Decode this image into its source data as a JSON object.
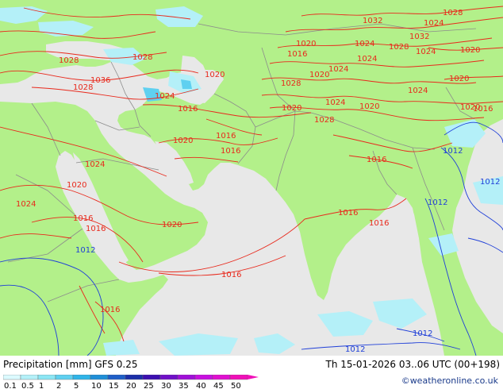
{
  "map": {
    "colors": {
      "land": "#b3f08a",
      "sea": "#e8e8e8",
      "isobar": "#e8291c",
      "isobar_low": "#1f3fd8",
      "border": "#8c8c8c",
      "precip_light": "#b4f0f8",
      "precip_mid": "#5fd0f0"
    },
    "isobar_labels_red": [
      {
        "text": "1028"
      },
      {
        "text": "1032"
      },
      {
        "text": "1024"
      },
      {
        "text": "1028"
      },
      {
        "text": "1032"
      },
      {
        "text": "1028"
      },
      {
        "text": "1024"
      },
      {
        "text": "1020"
      },
      {
        "text": "1020"
      },
      {
        "text": "1016"
      },
      {
        "text": "1024"
      },
      {
        "text": "1024"
      },
      {
        "text": "1028"
      },
      {
        "text": "1028"
      },
      {
        "text": "1020"
      },
      {
        "text": "1036"
      },
      {
        "text": "1028"
      },
      {
        "text": "1024"
      },
      {
        "text": "1016"
      },
      {
        "text": "1020"
      },
      {
        "text": "1024"
      },
      {
        "text": "1020"
      },
      {
        "text": "1020"
      },
      {
        "text": "1016"
      },
      {
        "text": "1020"
      },
      {
        "text": "1016"
      },
      {
        "text": "1016"
      },
      {
        "text": "1024"
      },
      {
        "text": "1020"
      },
      {
        "text": "1024"
      },
      {
        "text": "1016"
      },
      {
        "text": "1016"
      },
      {
        "text": "1020"
      },
      {
        "text": "1016"
      },
      {
        "text": "1016"
      },
      {
        "text": "1016"
      },
      {
        "text": "1016"
      },
      {
        "text": "1028"
      },
      {
        "text": "1020"
      },
      {
        "text": "1024"
      },
      {
        "text": "1020"
      },
      {
        "text": "1024"
      },
      {
        "text": "1016"
      }
    ],
    "isobar_labels_blue": [
      {
        "text": "1012"
      },
      {
        "text": "1012"
      },
      {
        "text": "1012"
      },
      {
        "text": "1012"
      },
      {
        "text": "1012"
      },
      {
        "text": "1012"
      }
    ]
  },
  "footer": {
    "title_left": "Precipitation [mm]  GFS 0.25",
    "title_right": "Th 15-01-2026 03..06 UTC (00+198)",
    "credit": "©weatheronline.co.uk",
    "scale": {
      "ticks": [
        "0.1",
        "0.5",
        "1",
        "2",
        "5",
        "10",
        "15",
        "20",
        "25",
        "30",
        "35",
        "40",
        "45",
        "50"
      ],
      "colors": [
        "#dcfaff",
        "#b4f0f8",
        "#8ce6f4",
        "#5fd0f0",
        "#2fb4e8",
        "#1f8fd8",
        "#1f5fc8",
        "#1c2fa8",
        "#3c0fb0",
        "#7010c8",
        "#a010d8",
        "#c810e0",
        "#e010d0",
        "#f010b8"
      ]
    }
  }
}
